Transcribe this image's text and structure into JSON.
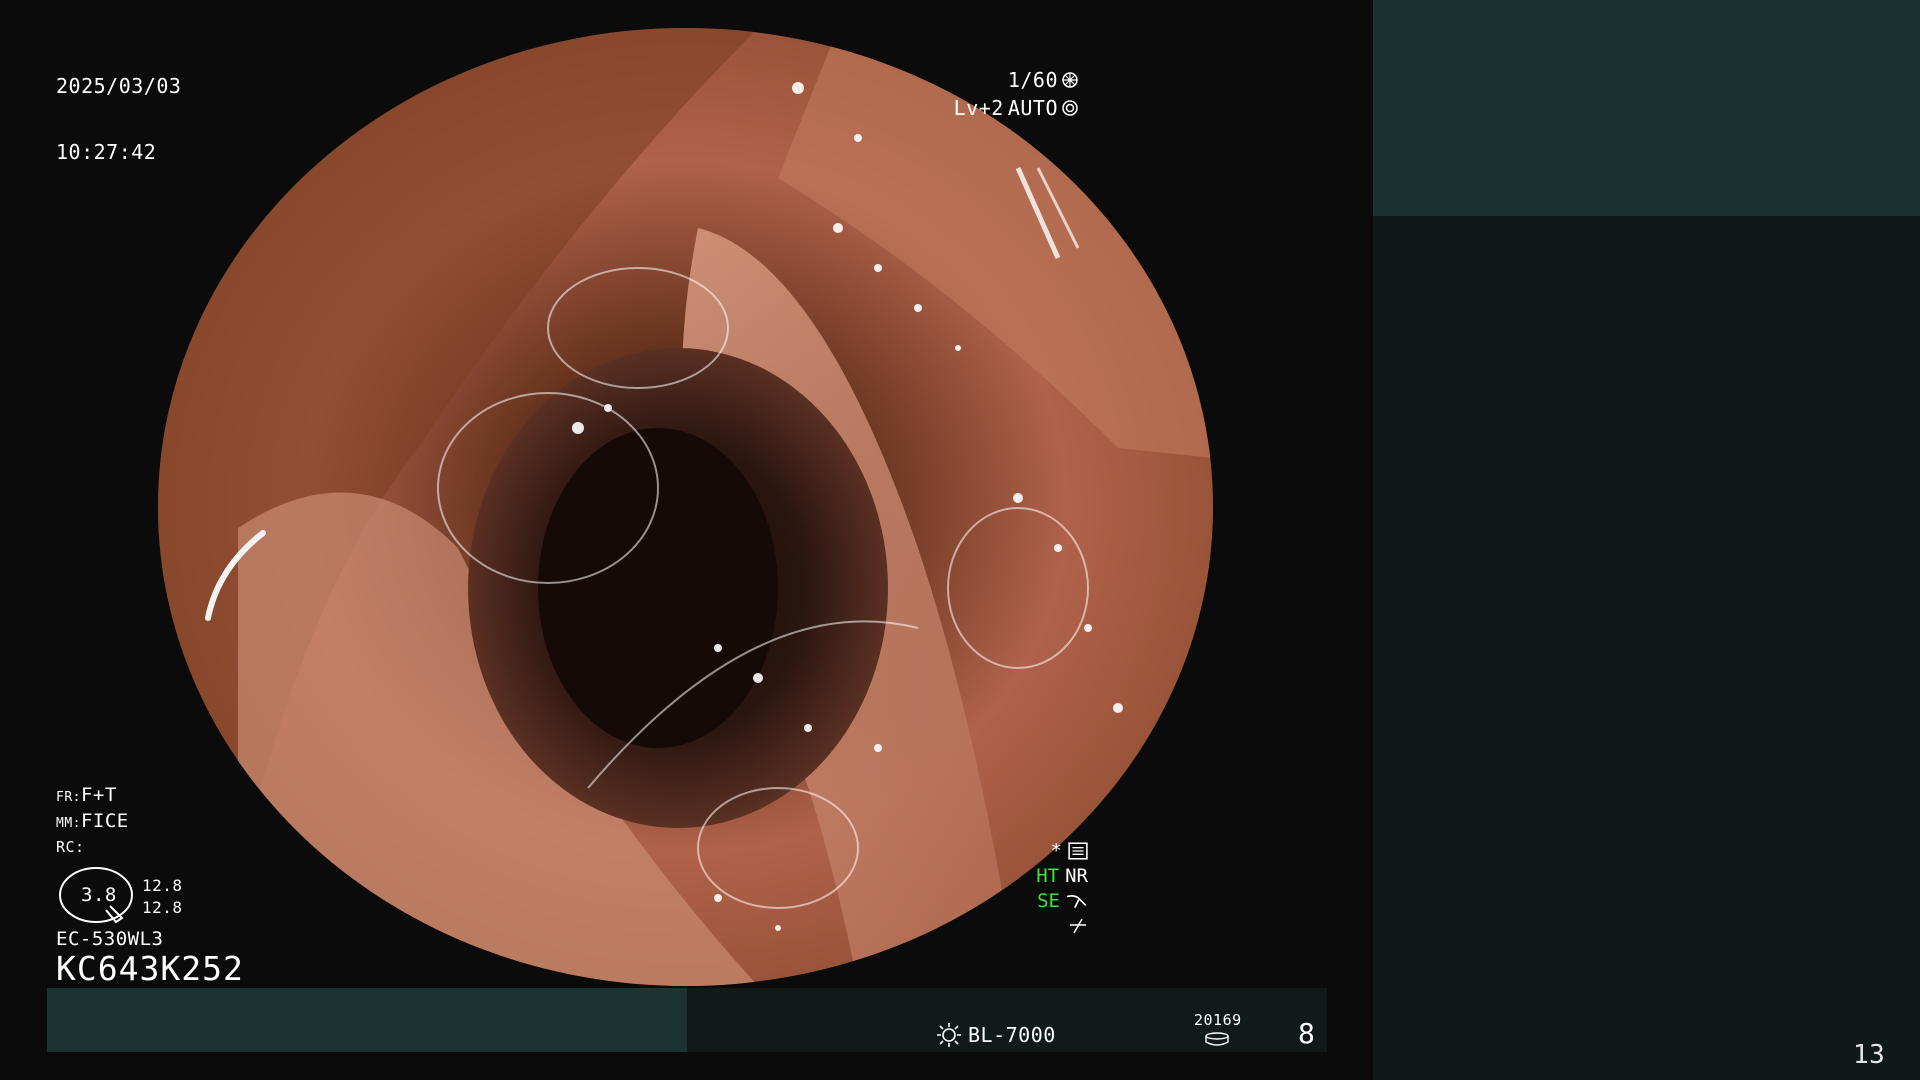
{
  "overlay": {
    "date": "2025/03/03",
    "time": "10:27:42",
    "shutter": "1/60",
    "level": "Lv+2",
    "iris_mode": "AUTO",
    "fr_label": "FR:",
    "fr_value": "F+T",
    "mm_label": "MM:",
    "mm_value": "FICE",
    "rc_label": "RC:",
    "zoom_value": "3.8",
    "zoom_range_1": "12.8",
    "zoom_range_2": "12.8",
    "scope_model": "EC-530WL3",
    "scope_serial": "KC643K252"
  },
  "status": {
    "star": "*",
    "ht": "HT",
    "nr": "NR",
    "se": "SE"
  },
  "bottom_bar": {
    "light_source": "BL-7000",
    "counter": "20169",
    "image_count": "8"
  },
  "side_panel": {
    "page_number": "13"
  },
  "colors": {
    "panel_top": "#1b3330",
    "panel_bottom": "#0f1a18",
    "bar_left": "#1c3431",
    "status_green": "#39e639"
  },
  "icons": {
    "shutter": "aperture-icon",
    "iris": "iris-icon",
    "menu": "menu-list-icon",
    "se": "enhance-curve-icon",
    "edge": "edge-icon",
    "light": "lamp-icon",
    "counter": "storage-disk-icon"
  }
}
